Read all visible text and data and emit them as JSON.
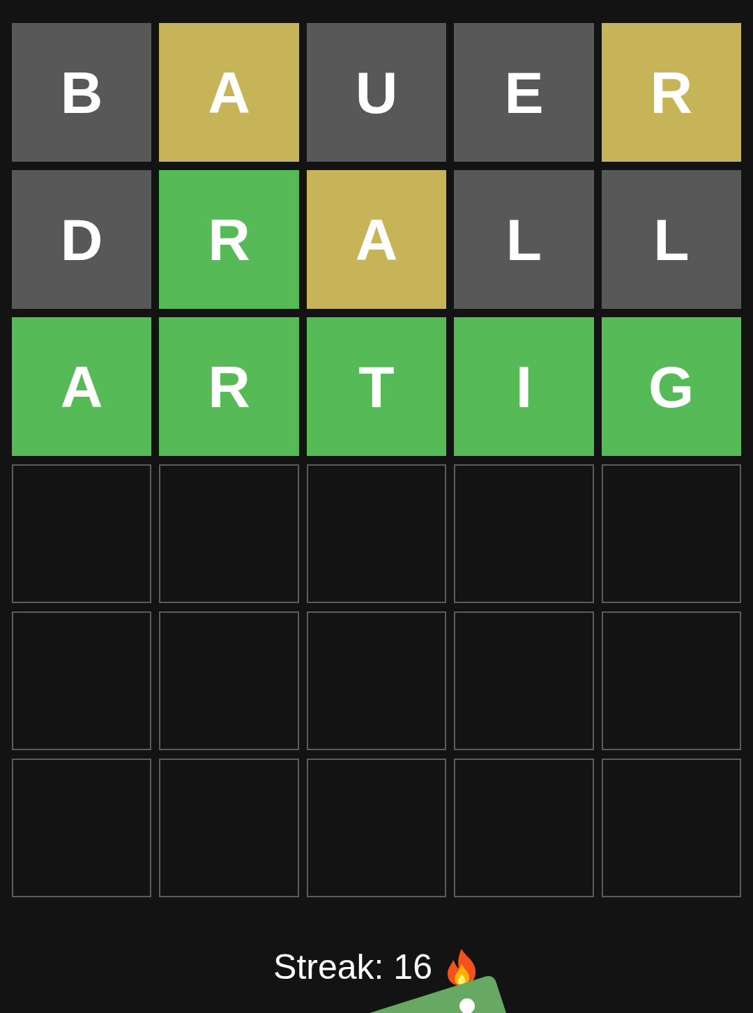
{
  "board": {
    "rows": [
      {
        "tiles": [
          {
            "letter": "B",
            "kind": "absent"
          },
          {
            "letter": "A",
            "kind": "present"
          },
          {
            "letter": "U",
            "kind": "absent"
          },
          {
            "letter": "E",
            "kind": "absent"
          },
          {
            "letter": "R",
            "kind": "present"
          }
        ]
      },
      {
        "tiles": [
          {
            "letter": "D",
            "kind": "absent"
          },
          {
            "letter": "R",
            "kind": "correct"
          },
          {
            "letter": "A",
            "kind": "present"
          },
          {
            "letter": "L",
            "kind": "absent"
          },
          {
            "letter": "L",
            "kind": "absent"
          }
        ]
      },
      {
        "tiles": [
          {
            "letter": "A",
            "kind": "correct"
          },
          {
            "letter": "R",
            "kind": "correct"
          },
          {
            "letter": "T",
            "kind": "correct"
          },
          {
            "letter": "I",
            "kind": "correct"
          },
          {
            "letter": "G",
            "kind": "correct"
          }
        ]
      },
      {
        "tiles": [
          {
            "kind": "empty"
          },
          {
            "kind": "empty"
          },
          {
            "kind": "empty"
          },
          {
            "kind": "empty"
          },
          {
            "kind": "empty"
          }
        ]
      },
      {
        "tiles": [
          {
            "kind": "empty"
          },
          {
            "kind": "empty"
          },
          {
            "kind": "empty"
          },
          {
            "kind": "empty"
          },
          {
            "kind": "empty"
          }
        ]
      },
      {
        "tiles": [
          {
            "kind": "empty"
          },
          {
            "kind": "empty"
          },
          {
            "kind": "empty"
          },
          {
            "kind": "empty"
          },
          {
            "kind": "empty"
          }
        ]
      }
    ]
  },
  "streak": {
    "label": "Streak: 16"
  }
}
